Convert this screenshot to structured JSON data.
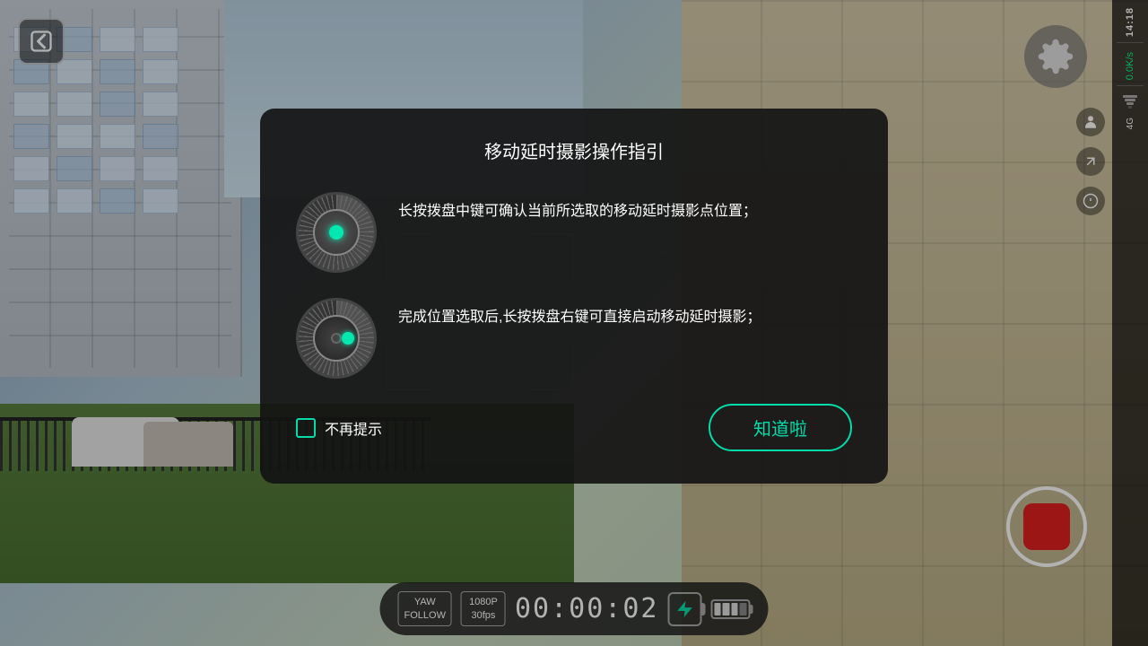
{
  "app": {
    "title": "移动延时摄影操作指引"
  },
  "status_bar": {
    "time": "14:18",
    "network_speed": "0.0K/s",
    "signal": "4G"
  },
  "dialog": {
    "title": "移动延时摄影操作指引",
    "instruction1": "长按拨盘中键可确认当前所选取的移动延时摄影点位置；",
    "instruction2": "完成位置选取后,长按拨盘右键可直接启动移动延时摄影；",
    "no_remind_label": "不再提示",
    "confirm_label": "知道啦"
  },
  "bottom_bar": {
    "yaw_line1": "YAW",
    "yaw_line2": "FOLLOW",
    "res_line1": "1080P",
    "res_line2": "30fps",
    "timer": "00:00:02"
  }
}
